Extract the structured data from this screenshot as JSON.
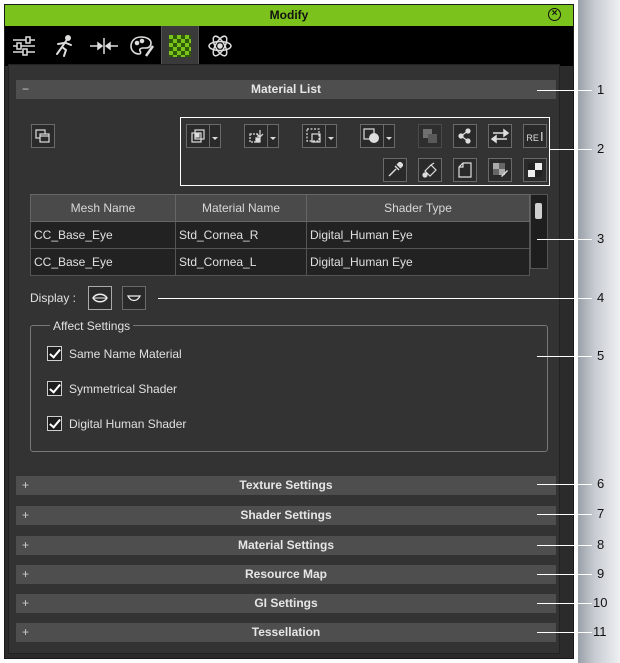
{
  "window": {
    "title": "Modify"
  },
  "tabs": [
    {
      "icon": "sliders-icon"
    },
    {
      "icon": "runner-icon"
    },
    {
      "icon": "align-icon"
    },
    {
      "icon": "palette-icon"
    },
    {
      "icon": "checker-icon",
      "active": true
    },
    {
      "icon": "atom-icon"
    }
  ],
  "material_list": {
    "header": "Material List",
    "collapse_sign": "−",
    "table": {
      "columns": [
        "Mesh Name",
        "Material Name",
        "Shader Type"
      ],
      "rows": [
        [
          "CC_Base_Eye",
          "Std_Cornea_R",
          "Digital_Human Eye"
        ],
        [
          "CC_Base_Eye",
          "Std_Cornea_L",
          "Digital_Human Eye"
        ]
      ]
    },
    "display_label": "Display :",
    "affect_settings": {
      "legend": "Affect Settings",
      "options": [
        {
          "label": "Same Name Material",
          "checked": true
        },
        {
          "label": "Symmetrical Shader",
          "checked": true
        },
        {
          "label": "Digital Human Shader",
          "checked": true
        }
      ]
    },
    "toolbar_re_label": "RE"
  },
  "collapsed_sections": [
    {
      "label": "Texture Settings",
      "sign": "+"
    },
    {
      "label": "Shader Settings",
      "sign": "+"
    },
    {
      "label": "Material Settings",
      "sign": "+"
    },
    {
      "label": "Resource Map",
      "sign": "+"
    },
    {
      "label": "GI Settings",
      "sign": "+"
    },
    {
      "label": "Tessellation",
      "sign": "+"
    }
  ],
  "callouts": [
    "1",
    "2",
    "3",
    "4",
    "5",
    "6",
    "7",
    "8",
    "9",
    "10",
    "11"
  ],
  "colors": {
    "accent": "#7cc21d",
    "panel": "#2b2b2b",
    "header": "#4e4e4e"
  }
}
